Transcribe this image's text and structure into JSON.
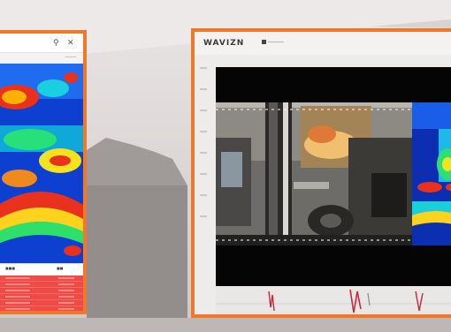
{
  "colors": {
    "frame_accent": "#f0782a",
    "alarm_red": "#ef4a45",
    "thermal_hot": "#e8321e",
    "thermal_cold": "#0b2fb0",
    "trace": "#c8283c"
  },
  "left_device": {
    "header_icons": [
      "search-icon",
      "close-icon"
    ],
    "alarm_rows": 6
  },
  "right_monitor": {
    "brand": "WAVIZN",
    "nav_icon": "camera-icon",
    "feeds": [
      "visual-camera",
      "thermal-camera"
    ],
    "playback_traces": 4
  }
}
